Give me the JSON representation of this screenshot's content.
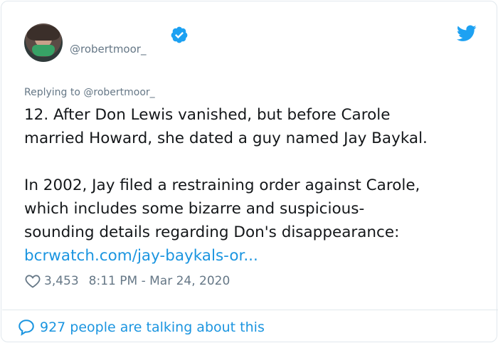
{
  "author": {
    "handle": "@robertmoor_",
    "avatar_icon": "profile-photo"
  },
  "icons": {
    "verified": "verified-badge-icon",
    "brand": "twitter-bird-icon",
    "like": "heart-icon",
    "reply": "speech-bubble-icon"
  },
  "colors": {
    "accent": "#1b95e0",
    "text": "#14171a",
    "muted": "#657786",
    "border": "#e1e8ed"
  },
  "tweet": {
    "replying_to": "Replying to @robertmoor_",
    "lines": [
      "12. After Don Lewis vanished, but before Carole",
      "married Howard, she dated a guy named Jay Baykal.",
      "In 2002, Jay filed a restraining order against Carole,",
      "which includes some bizarre and suspicious-",
      "sounding details regarding Don's disappearance:"
    ],
    "link": "bcrwatch.com/jay-baykals-or...",
    "likes": "3,453",
    "timestamp": "8:11 PM - Mar 24, 2020"
  },
  "footer": {
    "talking": "927 people are talking about this"
  }
}
